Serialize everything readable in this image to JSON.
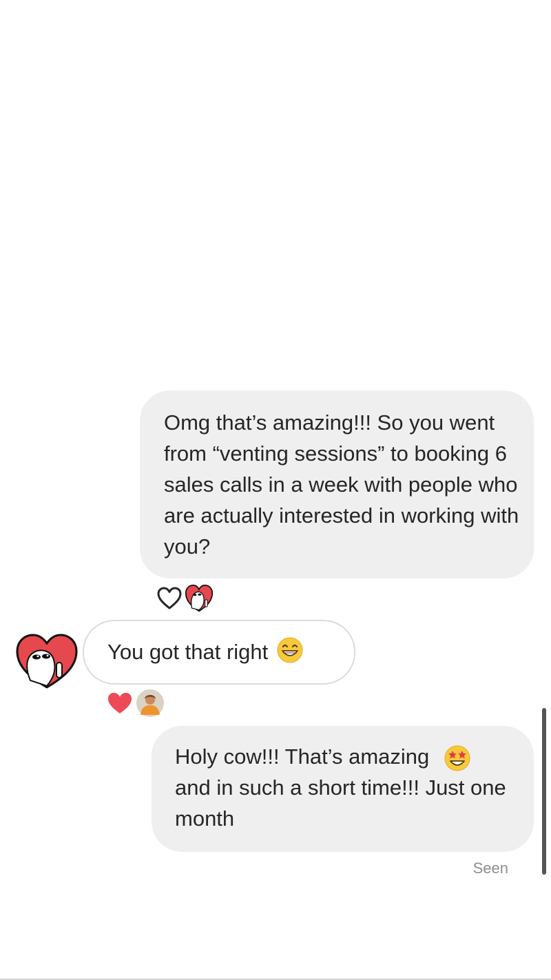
{
  "thread": {
    "messages": [
      {
        "sender": "me",
        "text": "Omg that’s amazing!!! So you went from “venting sessions” to booking 6 sales calls in a week with people who are actually interested in working with you?",
        "reactions": [
          "heart-outline-icon",
          "sticker-avatar"
        ]
      },
      {
        "sender": "them",
        "text": "You got that right",
        "emoji": "grinning-face-icon",
        "reactions": [
          "heart-filled-icon",
          "user-photo-avatar"
        ]
      },
      {
        "sender": "me",
        "text": "Holy cow!!! That’s amazing",
        "text_cont": "and in such a short time!!! Just one month",
        "emoji": "star-struck-icon"
      }
    ],
    "seen_label": "Seen"
  },
  "colors": {
    "outgoing_bubble": "#efefef",
    "incoming_border": "#dbdbdb",
    "heart_red": "#ed4956",
    "sticker_red": "#e5484d",
    "text": "#262626",
    "seen_text": "#8e8e8e"
  }
}
